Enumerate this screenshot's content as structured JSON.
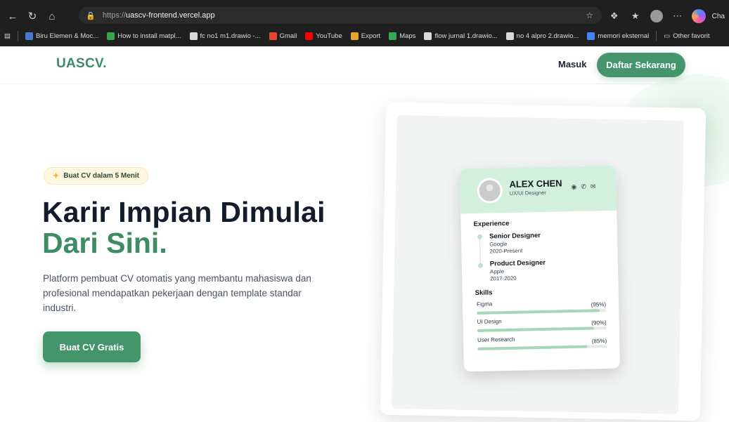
{
  "browser": {
    "url_prefix": "https://",
    "url_host": "uascv-frontend.vercel.app",
    "copilot_label": "Cha",
    "bookmarks": [
      {
        "label": "Biru Elemen & Moc...",
        "color": "#4a78d6"
      },
      {
        "label": "How to install matpl...",
        "color": "#3aa54d"
      },
      {
        "label": "fc no1 m1.drawio -...",
        "color": "#d9d9d9"
      },
      {
        "label": "Gmail",
        "color": "#ea4335"
      },
      {
        "label": "YouTube",
        "color": "#ff0000"
      },
      {
        "label": "Export",
        "color": "#e7a628"
      },
      {
        "label": "Maps",
        "color": "#34a853"
      },
      {
        "label": "flow jurnal 1.drawio...",
        "color": "#d9d9d9"
      },
      {
        "label": "no 4 alpro 2.drawio...",
        "color": "#d9d9d9"
      },
      {
        "label": "memori eksternal",
        "color": "#4285f4"
      }
    ],
    "other_favorites": "Other favorit"
  },
  "nav": {
    "logo": "UASCV.",
    "login": "Masuk",
    "signup": "Daftar Sekarang"
  },
  "hero": {
    "badge": "Buat CV dalam 5 Menit",
    "title_line1": "Karir Impian Dimulai",
    "title_line2": "Dari Sini.",
    "description": "Platform pembuat CV otomatis yang membantu mahasiswa dan profesional mendapatkan pekerjaan dengan template standar industri.",
    "cta": "Buat CV Gratis"
  },
  "cv_preview": {
    "name": "ALEX CHEN",
    "role": "UX/UI Designer",
    "experience_title": "Experience",
    "experience": [
      {
        "title": "Senior Designer",
        "company": "Google",
        "period": "2020-Present"
      },
      {
        "title": "Product Designer",
        "company": "Apple",
        "period": "2017-2020"
      }
    ],
    "skills_title": "Skills",
    "skills": [
      {
        "name": "Figma",
        "pct_label": "(95%)",
        "level": 0.95
      },
      {
        "name": "UI Design",
        "pct_label": "(90%)",
        "level": 0.9
      },
      {
        "name": "User Research",
        "pct_label": "(85%)",
        "level": 0.85
      }
    ]
  },
  "colors": {
    "brand": "#45956a",
    "brand_text": "#3d8c62",
    "heading": "#141c2c"
  }
}
